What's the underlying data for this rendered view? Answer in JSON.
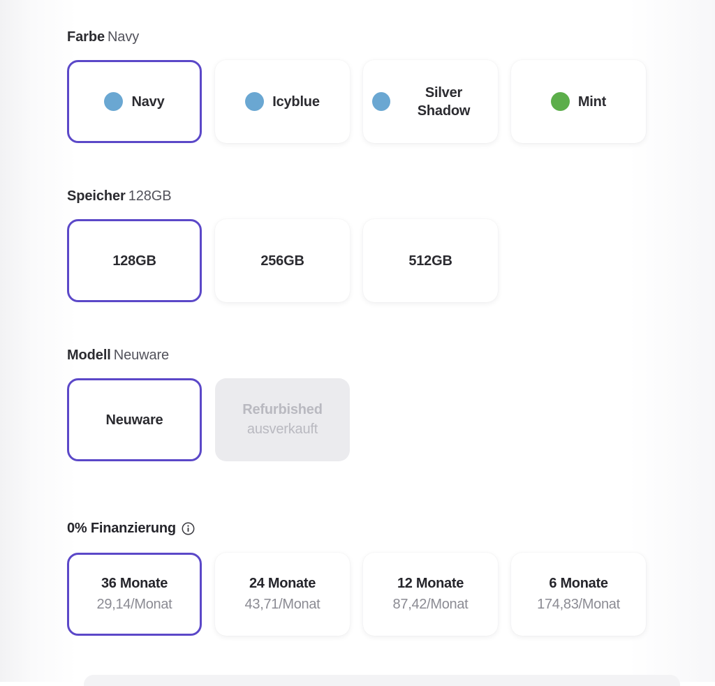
{
  "sections": {
    "color": {
      "label": "Farbe",
      "selected_value": "Navy",
      "options": [
        {
          "name": "Navy",
          "swatch_color": "#6aa7d2",
          "selected": true,
          "disabled": false
        },
        {
          "name": "Icyblue",
          "swatch_color": "#6aa7d2",
          "selected": false,
          "disabled": false
        },
        {
          "name": "Silver Shadow",
          "swatch_color": "#6aa7d2",
          "selected": false,
          "disabled": false
        },
        {
          "name": "Mint",
          "swatch_color": "#5cae4a",
          "selected": false,
          "disabled": false
        }
      ]
    },
    "storage": {
      "label": "Speicher",
      "selected_value": "128GB",
      "options": [
        {
          "name": "128GB",
          "selected": true,
          "disabled": false
        },
        {
          "name": "256GB",
          "selected": false,
          "disabled": false
        },
        {
          "name": "512GB",
          "selected": false,
          "disabled": false
        }
      ]
    },
    "model": {
      "label": "Modell",
      "selected_value": "Neuware",
      "options": [
        {
          "name": "Neuware",
          "sub": "",
          "selected": true,
          "disabled": false
        },
        {
          "name": "Refurbished",
          "sub": "ausverkauft",
          "selected": false,
          "disabled": true
        }
      ]
    },
    "financing": {
      "title": "0% Finanzierung",
      "info_icon": "info-circle-icon",
      "options": [
        {
          "term": "36 Monate",
          "rate": "29,14/Monat",
          "selected": true
        },
        {
          "term": "24 Monate",
          "rate": "43,71/Monat",
          "selected": false
        },
        {
          "term": "12 Monate",
          "rate": "87,42/Monat",
          "selected": false
        },
        {
          "term": "6 Monate",
          "rate": "174,83/Monat",
          "selected": false
        }
      ]
    }
  },
  "colors": {
    "accent": "#5b48c8",
    "text_primary": "#2b2b30",
    "text_muted": "#8b8b93",
    "disabled_bg": "#ebebee",
    "disabled_text": "#b9b9c0"
  }
}
